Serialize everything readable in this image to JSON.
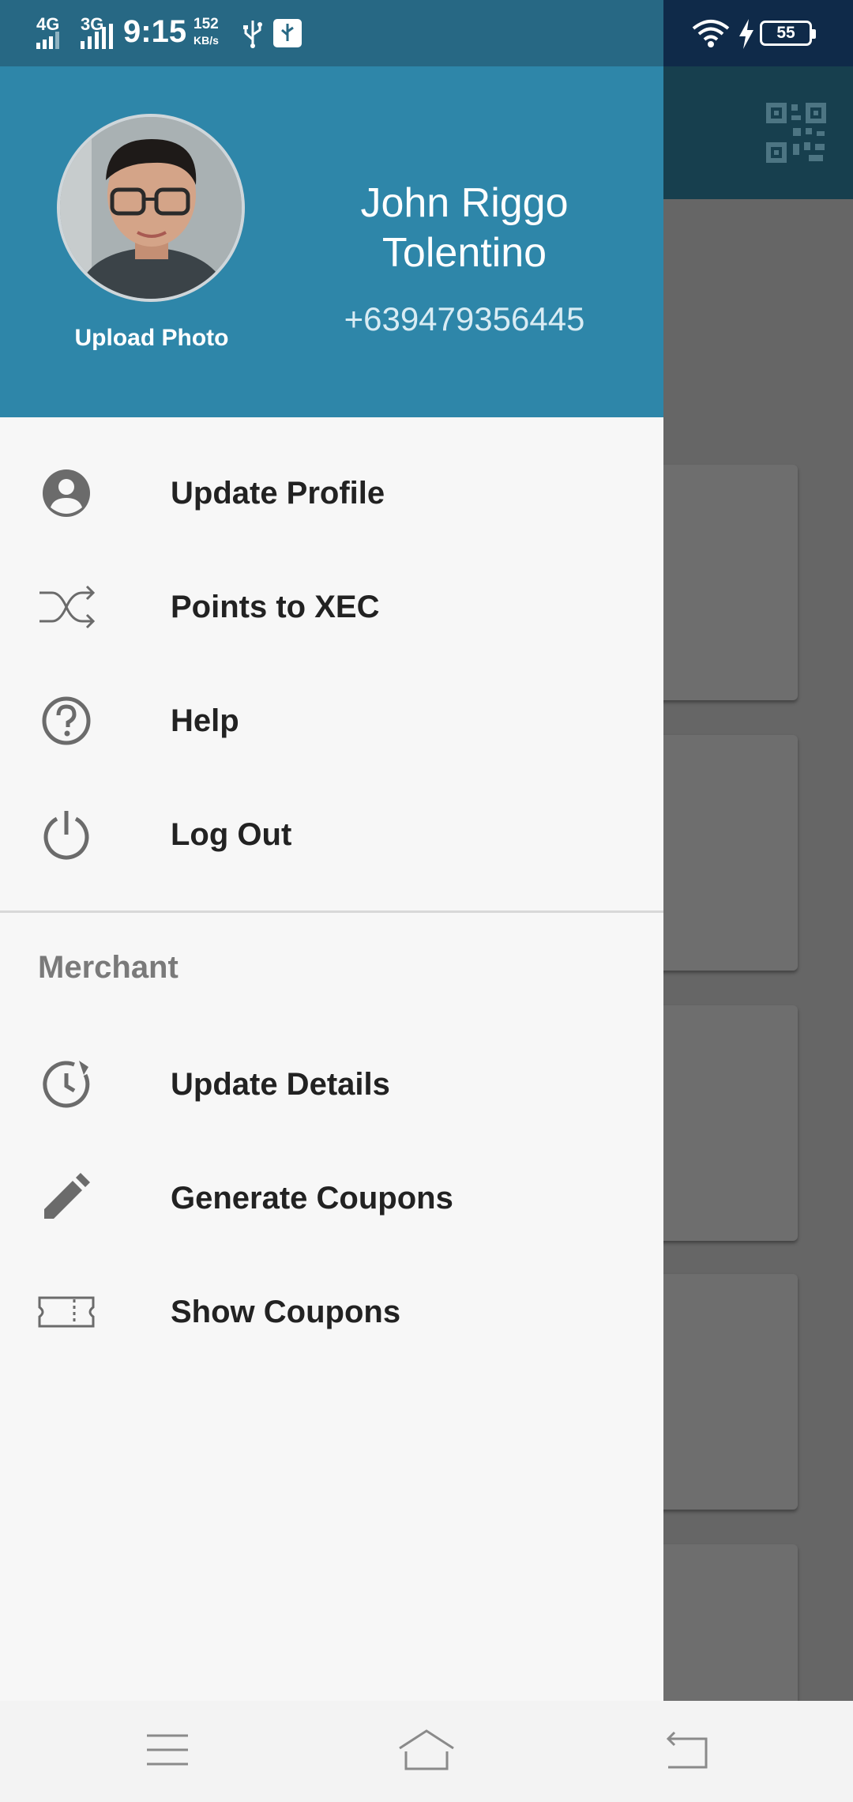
{
  "status_bar": {
    "network_1": "4G",
    "network_2": "3G",
    "time": "9:15",
    "speed_value": "152",
    "speed_unit": "KB/s",
    "battery": "55"
  },
  "drawer": {
    "upload_photo_label": "Upload Photo",
    "user_name": "John Riggo Tolentino",
    "user_phone": "+639479356445",
    "menu_items": [
      {
        "label": "Update Profile",
        "icon": "account-circle-icon"
      },
      {
        "label": "Points to XEC",
        "icon": "shuffle-icon"
      },
      {
        "label": "Help",
        "icon": "help-circle-icon"
      },
      {
        "label": "Log Out",
        "icon": "power-icon"
      }
    ],
    "merchant_section_title": "Merchant",
    "merchant_items": [
      {
        "label": "Update Details",
        "icon": "update-icon"
      },
      {
        "label": "Generate Coupons",
        "icon": "pencil-icon"
      },
      {
        "label": "Show Coupons",
        "icon": "ticket-icon"
      }
    ]
  },
  "nav_bar": {
    "buttons": [
      "menu-icon",
      "home-icon",
      "back-icon"
    ]
  }
}
